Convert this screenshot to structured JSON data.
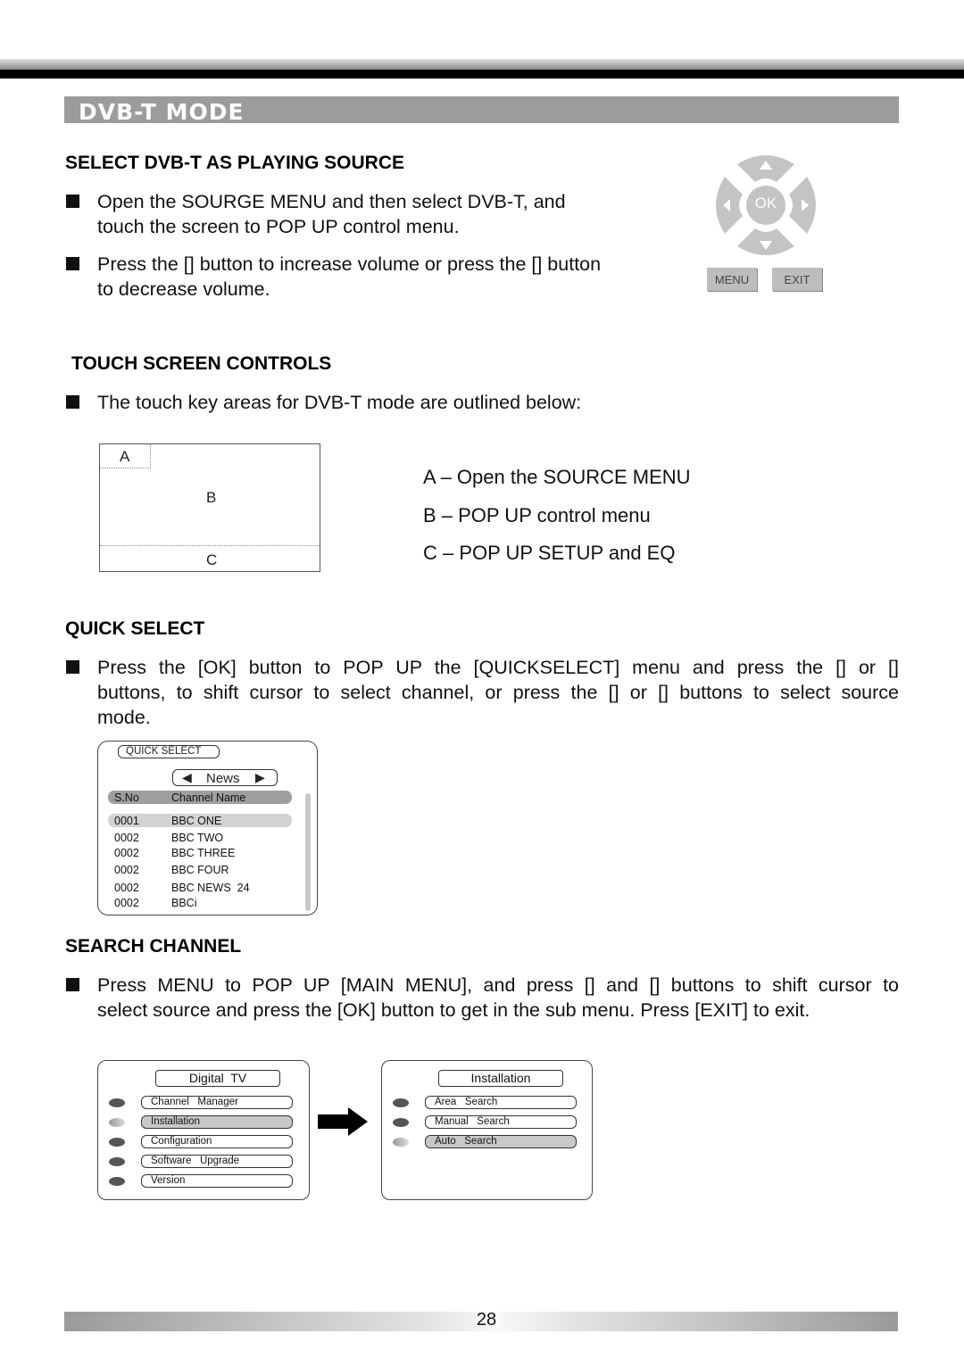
{
  "banner": {
    "title": "DVB-T MODE"
  },
  "section1": {
    "heading": "SELECT DVB-T AS PLAYING SOURCE",
    "bullets": [
      {
        "line1": "Open the SOURGE MENU and then select DVB-T, and",
        "line2": "touch the screen to POP UP control menu."
      },
      {
        "line1": "Press the [] button to increase volume or press the [] button",
        "line2": "to decrease volume."
      }
    ]
  },
  "remote": {
    "ok_label": "OK",
    "menu_label": "MENU",
    "exit_label": "EXIT",
    "up_icon": "▲",
    "down_icon": "▼",
    "left_icon": "◀",
    "right_icon": "▶"
  },
  "section2": {
    "heading": "TOUCH SCREEN CONTROLS",
    "bullet": "The touch key areas for DVB-T mode are outlined below:",
    "areas": {
      "a": "A",
      "b": "B",
      "c": "C"
    },
    "legend": [
      "A – Open the SOURCE MENU",
      "B – POP UP control menu",
      "C – POP UP SETUP and EQ"
    ]
  },
  "section3": {
    "heading": "QUICK SELECT",
    "bullet": {
      "line1": "Press the [OK] button to POP UP the [QUICKSELECT] menu and press the [] or []",
      "line2": "buttons, to shift cursor to select channel, or press the [] or [] buttons to select source",
      "line3": "mode."
    },
    "quick_select": {
      "title": "QUICK SELECT",
      "category": "News",
      "columns": [
        "S.No",
        "Channel Name"
      ],
      "rows": [
        {
          "no": "0001",
          "name": "BBC ONE"
        },
        {
          "no": "0002",
          "name": "BBC TWO"
        },
        {
          "no": "0002",
          "name": "BBC THREE"
        },
        {
          "no": "0002",
          "name": "BBC FOUR"
        },
        {
          "no": "0002",
          "name": "BBC NEWS  24"
        },
        {
          "no": "0002",
          "name": "BBCi"
        }
      ]
    }
  },
  "section4": {
    "heading": "SEARCH CHANNEL",
    "bullet": {
      "line1": "Press MENU to POP UP [MAIN MENU], and press [] and [] buttons to shift cursor to",
      "line2": "select source and press the [OK] button to get in the sub menu. Press [EXIT] to exit."
    },
    "main_menu": {
      "title": "Digital  TV",
      "items": [
        "Channel   Manager",
        "Installation",
        "Configuration",
        "Software   Upgrade",
        "Version"
      ]
    },
    "sub_menu": {
      "title": "Installation",
      "items": [
        "Area   Search",
        "Manual   Search",
        "Auto   Search"
      ]
    }
  },
  "footer": {
    "page_number": "28"
  }
}
